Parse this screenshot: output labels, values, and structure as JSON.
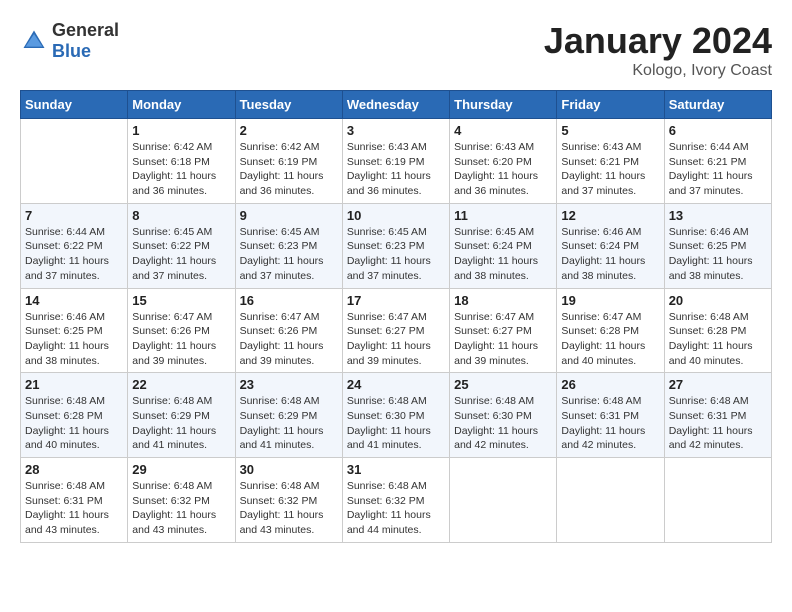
{
  "header": {
    "logo_general": "General",
    "logo_blue": "Blue",
    "month_title": "January 2024",
    "location": "Kologo, Ivory Coast"
  },
  "weekdays": [
    "Sunday",
    "Monday",
    "Tuesday",
    "Wednesday",
    "Thursday",
    "Friday",
    "Saturday"
  ],
  "weeks": [
    [
      {
        "day": "",
        "info": ""
      },
      {
        "day": "1",
        "info": "Sunrise: 6:42 AM\nSunset: 6:18 PM\nDaylight: 11 hours and 36 minutes."
      },
      {
        "day": "2",
        "info": "Sunrise: 6:42 AM\nSunset: 6:19 PM\nDaylight: 11 hours and 36 minutes."
      },
      {
        "day": "3",
        "info": "Sunrise: 6:43 AM\nSunset: 6:19 PM\nDaylight: 11 hours and 36 minutes."
      },
      {
        "day": "4",
        "info": "Sunrise: 6:43 AM\nSunset: 6:20 PM\nDaylight: 11 hours and 36 minutes."
      },
      {
        "day": "5",
        "info": "Sunrise: 6:43 AM\nSunset: 6:21 PM\nDaylight: 11 hours and 37 minutes."
      },
      {
        "day": "6",
        "info": "Sunrise: 6:44 AM\nSunset: 6:21 PM\nDaylight: 11 hours and 37 minutes."
      }
    ],
    [
      {
        "day": "7",
        "info": "Sunrise: 6:44 AM\nSunset: 6:22 PM\nDaylight: 11 hours and 37 minutes."
      },
      {
        "day": "8",
        "info": "Sunrise: 6:45 AM\nSunset: 6:22 PM\nDaylight: 11 hours and 37 minutes."
      },
      {
        "day": "9",
        "info": "Sunrise: 6:45 AM\nSunset: 6:23 PM\nDaylight: 11 hours and 37 minutes."
      },
      {
        "day": "10",
        "info": "Sunrise: 6:45 AM\nSunset: 6:23 PM\nDaylight: 11 hours and 37 minutes."
      },
      {
        "day": "11",
        "info": "Sunrise: 6:45 AM\nSunset: 6:24 PM\nDaylight: 11 hours and 38 minutes."
      },
      {
        "day": "12",
        "info": "Sunrise: 6:46 AM\nSunset: 6:24 PM\nDaylight: 11 hours and 38 minutes."
      },
      {
        "day": "13",
        "info": "Sunrise: 6:46 AM\nSunset: 6:25 PM\nDaylight: 11 hours and 38 minutes."
      }
    ],
    [
      {
        "day": "14",
        "info": "Sunrise: 6:46 AM\nSunset: 6:25 PM\nDaylight: 11 hours and 38 minutes."
      },
      {
        "day": "15",
        "info": "Sunrise: 6:47 AM\nSunset: 6:26 PM\nDaylight: 11 hours and 39 minutes."
      },
      {
        "day": "16",
        "info": "Sunrise: 6:47 AM\nSunset: 6:26 PM\nDaylight: 11 hours and 39 minutes."
      },
      {
        "day": "17",
        "info": "Sunrise: 6:47 AM\nSunset: 6:27 PM\nDaylight: 11 hours and 39 minutes."
      },
      {
        "day": "18",
        "info": "Sunrise: 6:47 AM\nSunset: 6:27 PM\nDaylight: 11 hours and 39 minutes."
      },
      {
        "day": "19",
        "info": "Sunrise: 6:47 AM\nSunset: 6:28 PM\nDaylight: 11 hours and 40 minutes."
      },
      {
        "day": "20",
        "info": "Sunrise: 6:48 AM\nSunset: 6:28 PM\nDaylight: 11 hours and 40 minutes."
      }
    ],
    [
      {
        "day": "21",
        "info": "Sunrise: 6:48 AM\nSunset: 6:28 PM\nDaylight: 11 hours and 40 minutes."
      },
      {
        "day": "22",
        "info": "Sunrise: 6:48 AM\nSunset: 6:29 PM\nDaylight: 11 hours and 41 minutes."
      },
      {
        "day": "23",
        "info": "Sunrise: 6:48 AM\nSunset: 6:29 PM\nDaylight: 11 hours and 41 minutes."
      },
      {
        "day": "24",
        "info": "Sunrise: 6:48 AM\nSunset: 6:30 PM\nDaylight: 11 hours and 41 minutes."
      },
      {
        "day": "25",
        "info": "Sunrise: 6:48 AM\nSunset: 6:30 PM\nDaylight: 11 hours and 42 minutes."
      },
      {
        "day": "26",
        "info": "Sunrise: 6:48 AM\nSunset: 6:31 PM\nDaylight: 11 hours and 42 minutes."
      },
      {
        "day": "27",
        "info": "Sunrise: 6:48 AM\nSunset: 6:31 PM\nDaylight: 11 hours and 42 minutes."
      }
    ],
    [
      {
        "day": "28",
        "info": "Sunrise: 6:48 AM\nSunset: 6:31 PM\nDaylight: 11 hours and 43 minutes."
      },
      {
        "day": "29",
        "info": "Sunrise: 6:48 AM\nSunset: 6:32 PM\nDaylight: 11 hours and 43 minutes."
      },
      {
        "day": "30",
        "info": "Sunrise: 6:48 AM\nSunset: 6:32 PM\nDaylight: 11 hours and 43 minutes."
      },
      {
        "day": "31",
        "info": "Sunrise: 6:48 AM\nSunset: 6:32 PM\nDaylight: 11 hours and 44 minutes."
      },
      {
        "day": "",
        "info": ""
      },
      {
        "day": "",
        "info": ""
      },
      {
        "day": "",
        "info": ""
      }
    ]
  ]
}
